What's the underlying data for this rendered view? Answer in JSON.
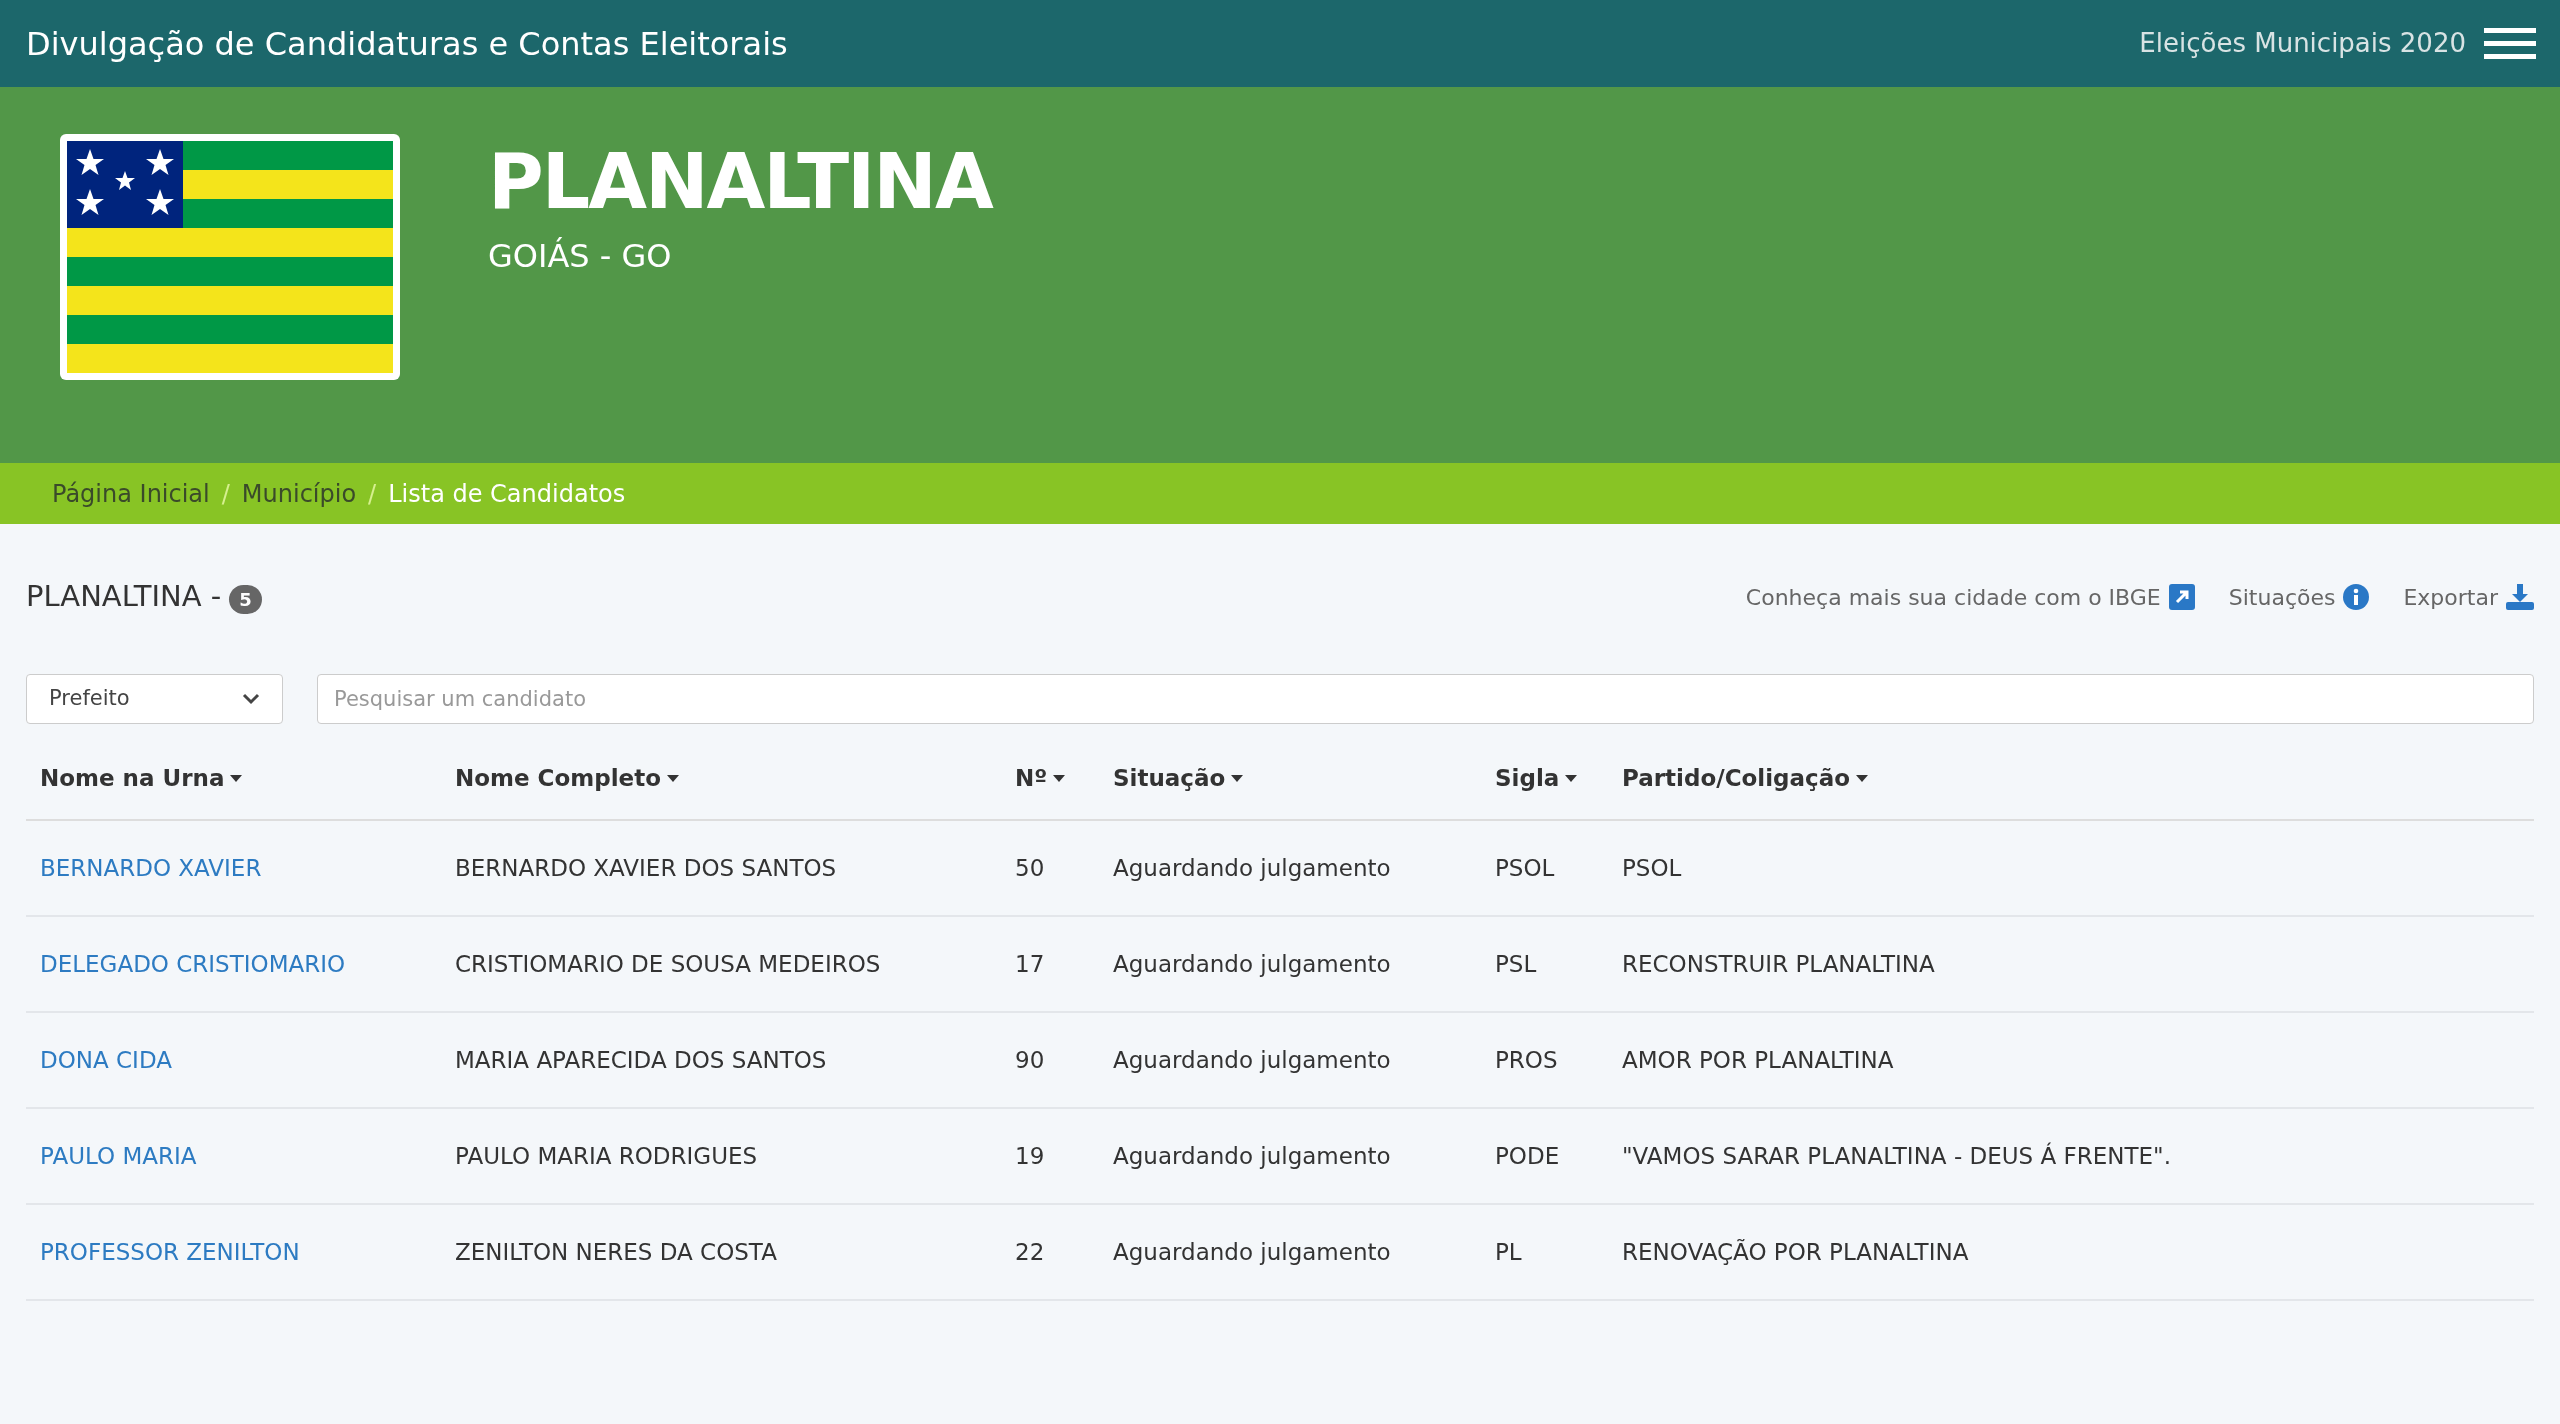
{
  "topbar": {
    "title": "Divulgação de Candidaturas e Contas Eleitorais",
    "election": "Eleições Municipais 2020"
  },
  "header": {
    "city": "PLANALTINA",
    "state": "GOIÁS - GO"
  },
  "breadcrumb_separator": "/",
  "breadcrumb": [
    {
      "label": "Página Inicial",
      "current": false
    },
    {
      "label": "Município",
      "current": false
    },
    {
      "label": "Lista de Candidatos",
      "current": true
    }
  ],
  "list_title": {
    "text": "PLANALTINA -",
    "count": "5"
  },
  "actions": [
    {
      "label": "Conheça mais sua cidade com o IBGE",
      "kind": "external"
    },
    {
      "label": "Situações",
      "kind": "info"
    },
    {
      "label": "Exportar",
      "kind": "download"
    }
  ],
  "filter": {
    "value": "Prefeito"
  },
  "search": {
    "placeholder": "Pesquisar um candidato"
  },
  "table": {
    "columns": [
      "Nome na Urna",
      "Nome Completo",
      "Nº",
      "Situação",
      "Sigla",
      "Partido/Coligação"
    ],
    "rows": [
      [
        "BERNARDO XAVIER",
        "BERNARDO XAVIER DOS SANTOS",
        "50",
        "Aguardando julgamento",
        "PSOL",
        "PSOL"
      ],
      [
        "DELEGADO CRISTIOMARIO",
        "CRISTIOMARIO DE SOUSA MEDEIROS",
        "17",
        "Aguardando julgamento",
        "PSL",
        "RECONSTRUIR PLANALTINA"
      ],
      [
        "DONA CIDA",
        "MARIA APARECIDA DOS SANTOS",
        "90",
        "Aguardando julgamento",
        "PROS",
        "AMOR POR PLANALTINA"
      ],
      [
        "PAULO MARIA",
        "PAULO MARIA RODRIGUES",
        "19",
        "Aguardando julgamento",
        "PODE",
        "\"VAMOS SARAR PLANALTINA - DEUS Á FRENTE\"."
      ],
      [
        "PROFESSOR ZENILTON",
        "ZENILTON NERES DA COSTA",
        "22",
        "Aguardando julgamento",
        "PL",
        "RENOVAÇÃO POR PLANALTINA"
      ]
    ]
  }
}
